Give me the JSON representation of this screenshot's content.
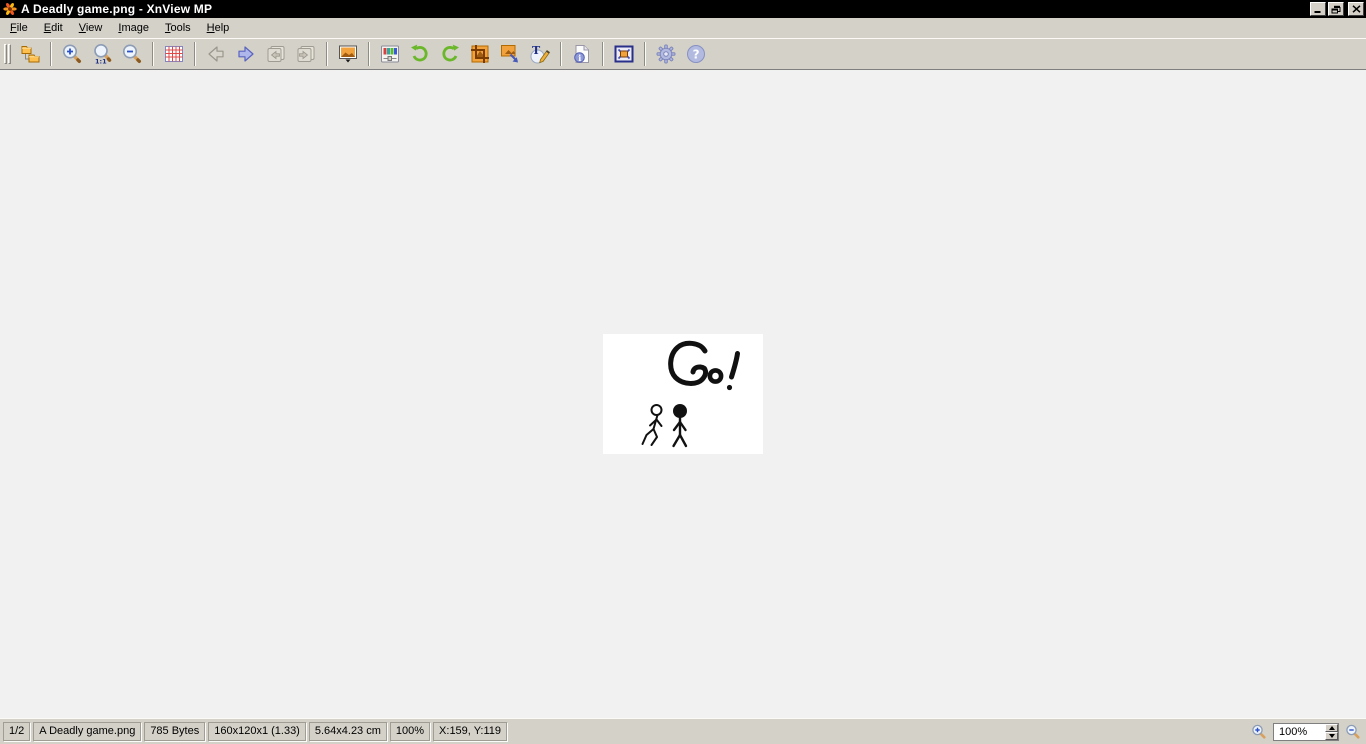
{
  "window": {
    "title": "A Deadly game.png - XnView MP",
    "app_name": "XnView MP"
  },
  "menu": {
    "items": [
      "File",
      "Edit",
      "View",
      "Image",
      "Tools",
      "Help"
    ]
  },
  "toolbar": {
    "buttons": [
      {
        "name": "browser",
        "enabled": true
      },
      {
        "name": "zoom-in",
        "enabled": true
      },
      {
        "name": "zoom-1-1",
        "enabled": true
      },
      {
        "name": "zoom-out",
        "enabled": true
      },
      {
        "name": "thumbnail-grid",
        "enabled": true
      },
      {
        "name": "previous-image",
        "enabled": false
      },
      {
        "name": "next-image",
        "enabled": true
      },
      {
        "name": "first-page",
        "enabled": false
      },
      {
        "name": "last-page",
        "enabled": false
      },
      {
        "name": "slideshow",
        "enabled": true
      },
      {
        "name": "adjust-colors",
        "enabled": true
      },
      {
        "name": "rotate-left",
        "enabled": true
      },
      {
        "name": "rotate-right",
        "enabled": true
      },
      {
        "name": "crop",
        "enabled": true
      },
      {
        "name": "resize",
        "enabled": true
      },
      {
        "name": "add-text",
        "enabled": true
      },
      {
        "name": "image-info",
        "enabled": true
      },
      {
        "name": "fullscreen",
        "enabled": true
      },
      {
        "name": "settings",
        "enabled": true
      },
      {
        "name": "help",
        "enabled": true
      }
    ]
  },
  "viewer": {
    "drawing_text": "Go!"
  },
  "statusbar": {
    "page_index": "1/2",
    "filename": "A Deadly game.png",
    "file_size": "785 Bytes",
    "dimensions": "160x120x1 (1.33)",
    "print_size": "5.64x4.23 cm",
    "zoom_percent": "100%",
    "cursor_position": "X:159, Y:119",
    "zoom_field_value": "100%"
  },
  "colors": {
    "titlebar": "#000000",
    "chrome": "#d4d1c8",
    "canvas": "#f1f1f1",
    "folder_orange": "#fdbf4e",
    "arrow_blue": "#aeb6ea",
    "grid_red": "#e04848",
    "rotate_green": "#6ab82a",
    "image_orange": "#f2a23c",
    "lavender": "#b2badf"
  }
}
